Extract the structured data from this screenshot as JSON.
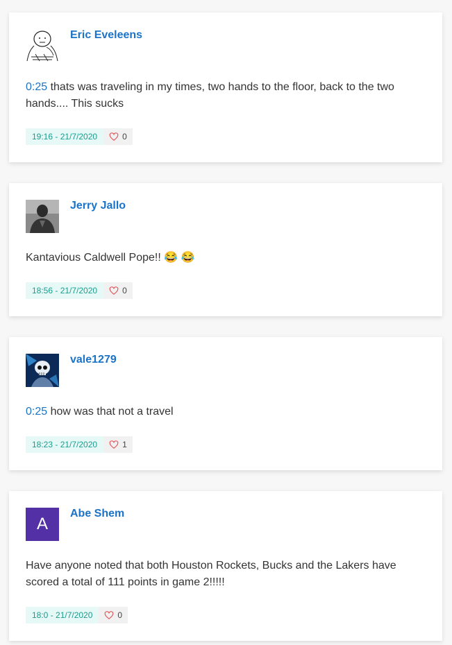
{
  "comments": [
    {
      "username": "Eric Eveleens",
      "timestamp": "0:25",
      "text": " thats was traveling in my times, two hands to the floor, back to the two hands.... This sucks",
      "date": "19:16 - 21/7/2020",
      "likes": "0",
      "avatar": "sketch-face-icon"
    },
    {
      "username": "Jerry Jallo",
      "text": "Kantavious Caldwell Pope!! 😂 😂",
      "date": "18:56 - 21/7/2020",
      "likes": "0",
      "avatar": "person-photo"
    },
    {
      "username": "vale1279",
      "timestamp": "0:25",
      "text": " how was that not a travel",
      "date": "18:23 - 21/7/2020",
      "likes": "1",
      "avatar": "skull-art"
    },
    {
      "username": "Abe Shem",
      "text": "Have anyone noted that both Houston Rockets, Bucks and the Lakers have scored a total of 111 points in game 2!!!!!",
      "date": "18:0 - 21/7/2020",
      "likes": "0",
      "avatar_letter": "A",
      "avatar_color": "#5330a6"
    }
  ],
  "colors": {
    "link": "#1a73c8",
    "date_bg": "#e6f9f7",
    "date_text": "#1a9c8c",
    "heart": "#e0474c"
  }
}
